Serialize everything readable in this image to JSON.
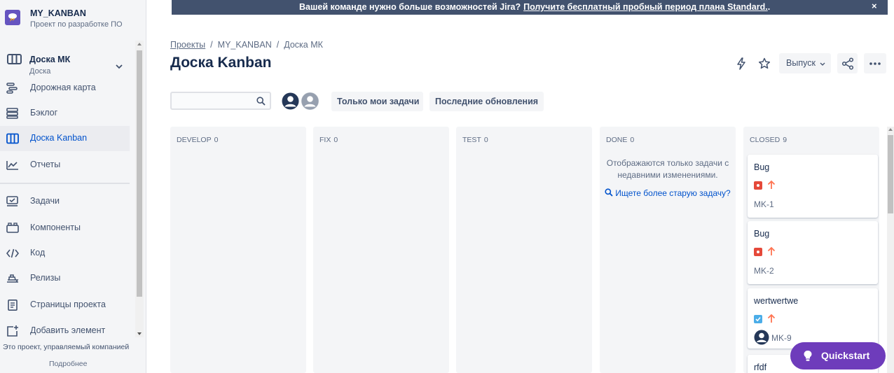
{
  "project": {
    "name": "MY_KANBAN",
    "type": "Проект по разработке ПО"
  },
  "sidebar": {
    "board": {
      "name": "Доска МК",
      "type": "Доска"
    },
    "items": [
      {
        "label": "Дорожная карта",
        "icon": "roadmap-icon"
      },
      {
        "label": "Бэклог",
        "icon": "backlog-icon"
      },
      {
        "label": "Доска Kanban",
        "icon": "board-icon",
        "active": true
      },
      {
        "label": "Отчеты",
        "icon": "reports-icon"
      },
      {
        "label": "Задачи",
        "icon": "issues-icon"
      },
      {
        "label": "Компоненты",
        "icon": "components-icon"
      },
      {
        "label": "Код",
        "icon": "code-icon"
      },
      {
        "label": "Релизы",
        "icon": "releases-icon"
      },
      {
        "label": "Страницы проекта",
        "icon": "pages-icon"
      },
      {
        "label": "Добавить элемент",
        "icon": "add-item-icon"
      }
    ],
    "footer": {
      "text": "Это проект, управляемый компанией",
      "link": "Подробнее"
    }
  },
  "banner": {
    "message": "Вашей команде нужно больше возможностей Jira?",
    "link": "Получите бесплатный пробный период плана Standard.",
    "suffix": ".",
    "close": "×"
  },
  "breadcrumbs": [
    "Проекты",
    "MY_KANBAN",
    "Доска МК"
  ],
  "page_title": "Доска Kanban",
  "toolbar": {
    "release_label": "Выпуск"
  },
  "filters": {
    "search_placeholder": "",
    "only_my_issues": "Только мои задачи",
    "recently_updated": "Последние обновления"
  },
  "columns": [
    {
      "name": "DEVELOP",
      "count": "0"
    },
    {
      "name": "FIX",
      "count": "0"
    },
    {
      "name": "TEST",
      "count": "0"
    },
    {
      "name": "DONE",
      "count": "0",
      "message": "Отображаются только задачи с недавними изменениями.",
      "link": "Ищете более старую задачу?"
    },
    {
      "name": "CLOSED",
      "count": "9"
    }
  ],
  "cards": [
    {
      "title": "Bug",
      "type": "bug",
      "priority": "high",
      "key": "MK-1"
    },
    {
      "title": "Bug",
      "type": "bug",
      "priority": "high",
      "key": "MK-2"
    },
    {
      "title": "wertwertwe",
      "type": "task",
      "priority": "high",
      "key": "MK-9",
      "assignee": true
    },
    {
      "title": "rfdf",
      "type": "task",
      "priority": "high",
      "key": ""
    }
  ],
  "quickstart": "Quickstart",
  "colors": {
    "accent": "#0052cc",
    "banner_bg": "#42526e",
    "quickstart_bg": "#6e3cbb",
    "bug": "#e5493a",
    "task": "#4bade8",
    "priority_high": "#ff7452"
  }
}
